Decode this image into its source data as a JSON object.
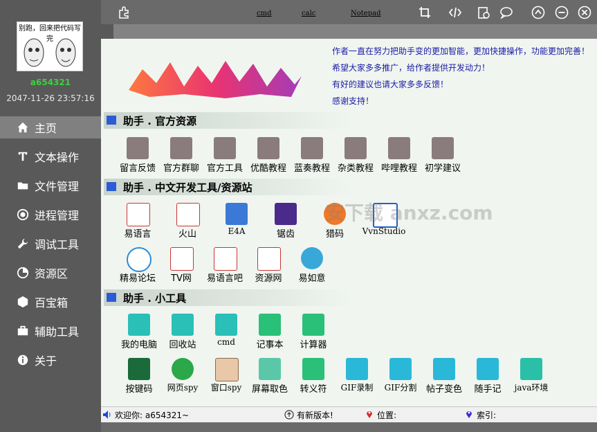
{
  "toolbar": {
    "links": [
      "cmd",
      "calc",
      "Notepad"
    ]
  },
  "user": {
    "avatar_caption": "别跑，回来把代码写完",
    "name": "a654321",
    "datetime": "2047-11-26 23:57:16"
  },
  "sidebar": {
    "items": [
      {
        "label": "主页",
        "icon": "home-icon"
      },
      {
        "label": "文本操作",
        "icon": "text-icon"
      },
      {
        "label": "文件管理",
        "icon": "folder-icon"
      },
      {
        "label": "进程管理",
        "icon": "radio-icon"
      },
      {
        "label": "调试工具",
        "icon": "wrench-icon"
      },
      {
        "label": "资源区",
        "icon": "pie-icon"
      },
      {
        "label": "百宝箱",
        "icon": "hexagon-icon"
      },
      {
        "label": "辅助工具",
        "icon": "briefcase-icon"
      },
      {
        "label": "关于",
        "icon": "info-icon"
      }
    ]
  },
  "banner": {
    "lines": [
      "作者一直在努力把助手变的更加智能，更加快捷操作，功能更加完善！",
      "希望大家多多推广，给作者提供开发动力！",
      "有好的建议也请大家多多反馈！",
      "感谢支持！"
    ]
  },
  "sections": [
    {
      "title": "助手 . 官方资源",
      "tools": [
        "留言反馈",
        "官方群聊",
        "官方工具",
        "优酷教程",
        "蓝奏教程",
        "杂类教程",
        "哔哩教程",
        "初学建议"
      ]
    },
    {
      "title": "助手 . 中文开发工具/资源站",
      "tools": [
        "易语言",
        "火山",
        "E4A",
        "锯齿",
        "猎码",
        "VvnStudio",
        "精易论坛",
        "TV网",
        "易语言吧",
        "资源网",
        "易如意"
      ]
    },
    {
      "title": "助手 . 小工具",
      "tools": [
        "我的电脑",
        "回收站",
        "cmd",
        "记事本",
        "计算器",
        "按键码",
        "网页spy",
        "窗口spy",
        "屏幕取色",
        "转义符",
        "GIF录制",
        "GIF分割",
        "帖子变色",
        "随手记",
        "java环境"
      ]
    }
  ],
  "status": {
    "welcome": "欢迎你: a654321~",
    "update": "有新版本!",
    "position_label": "位置:",
    "index_label": "索引:"
  },
  "watermark": "安下载 anxz.com",
  "colors": {
    "accent": "#2d5bd6",
    "username": "#3cd23c",
    "banner_text": "#1a1aa6"
  }
}
